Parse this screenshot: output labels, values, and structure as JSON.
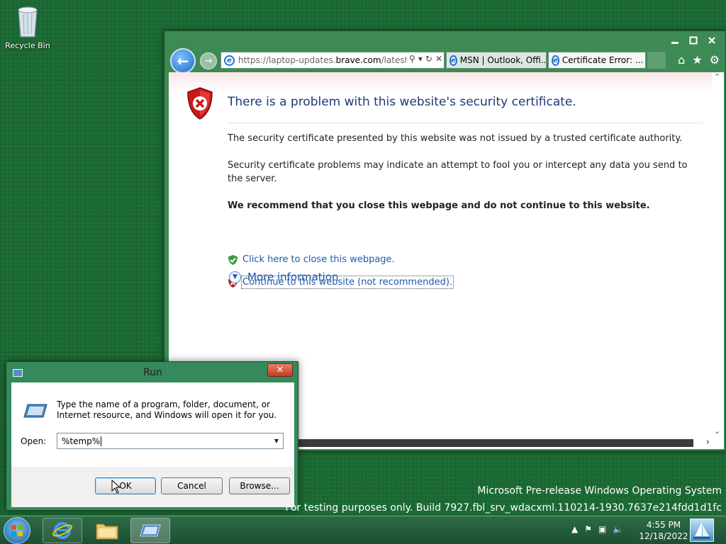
{
  "desktop": {
    "recycle_bin_label": "Recycle Bin"
  },
  "ie": {
    "address_url_prefix": "https://laptop-updates.",
    "address_url_domain": "brave.com",
    "address_url_suffix": "/latest/",
    "tabs": [
      {
        "label": "MSN | Outlook, Offi..."
      },
      {
        "label": "Certificate Error: ..."
      }
    ],
    "page": {
      "title": "There is a problem with this website's security certificate.",
      "para1": "The security certificate presented by this website was not issued by a trusted certificate authority.",
      "para2": "Security certificate problems may indicate an attempt to fool you or intercept any data you send to the server.",
      "recommend": "We recommend that you close this webpage and do not continue to this website.",
      "close_link": "Click here to close this webpage.",
      "continue_link": "Continue to this website (not recommended).",
      "more_info": "More information"
    }
  },
  "run_dialog": {
    "title": "Run",
    "description": "Type the name of a program, folder, document, or Internet resource, and Windows will open it for you.",
    "open_label": "Open:",
    "open_value": "%temp%",
    "ok_label": "OK",
    "cancel_label": "Cancel",
    "browse_label": "Browse..."
  },
  "watermark": {
    "line1": "Microsoft Pre-release Windows Operating System",
    "line2": "For testing purposes only. Build 7927.fbl_srv_wdacxml.110214-1930.7637e214fdd1d1fc"
  },
  "taskbar": {
    "time": "4:55 PM",
    "date": "12/18/2022"
  }
}
